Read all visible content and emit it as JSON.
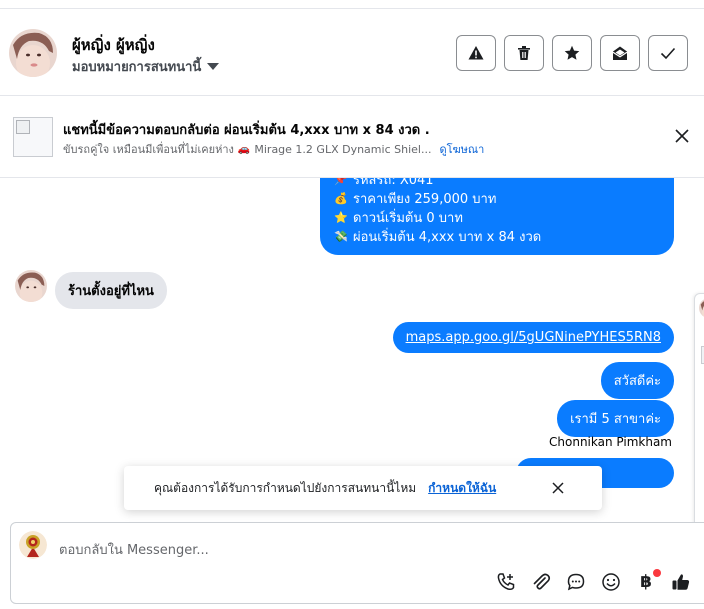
{
  "header": {
    "contact_name": "ผู้หญิ่ง ผู้หญิ่ง",
    "assign_label": "มอบหมายการสนทนานี้",
    "actions": [
      {
        "name": "mark-spam-button",
        "icon": "warning-icon"
      },
      {
        "name": "delete-button",
        "icon": "trash-icon"
      },
      {
        "name": "star-button",
        "icon": "star-icon"
      },
      {
        "name": "mark-unread-button",
        "icon": "open-envelope-icon"
      },
      {
        "name": "mark-done-button",
        "icon": "check-icon"
      }
    ]
  },
  "ad": {
    "title": "แชทนี้มีข้อความตอบกลับต่อ ผ่อนเริ่มต้น 4,xxx บาท x 84 งวด .",
    "subtitle_text": "ขับรถคู่ใจ เหมือนมีเพื่อนที่ไม่เคยห่าง",
    "car_emoji": "🚗",
    "subtitle_car": "Mirage 1.2 GLX Dynamic Shiel...",
    "tag": "ดูโฆษณา"
  },
  "messages": {
    "promo_lines": [
      {
        "emoji": "📌",
        "text": "รหัสรถ: X041"
      },
      {
        "emoji": "💰",
        "text": "ราคาเพียง 259,000 บาท"
      },
      {
        "emoji": "⭐",
        "text": "ดาวน์เริ่มต้น 0 บาท"
      },
      {
        "emoji": "💸",
        "text": "ผ่อนเริ่มต้น 4,xxx บาท x 84 งวด"
      }
    ],
    "incoming": "ร้านตั้งอยู่ที่ไหน",
    "link": "maps.app.goo.gl/5gUGNinePYHES5RN8",
    "greeting": "สวัสดีค่ะ",
    "branches": "เรามี 5 สาขาค่ะ",
    "sender_name": "Chonnikan Pimkham"
  },
  "toast": {
    "text": "คุณต้องการได้รับการกำหนดไปยังการสนทนานี้ไหม",
    "link": "กำหนดให้ฉัน"
  },
  "composer": {
    "placeholder": "ตอบกลับใน Messenger...",
    "baht_symbol": "฿"
  },
  "colors": {
    "outgoing_bubble": "#0a7cff",
    "incoming_bubble": "#e4e6eb",
    "link": "#0a63d6",
    "notification_dot": "#fa383e"
  }
}
